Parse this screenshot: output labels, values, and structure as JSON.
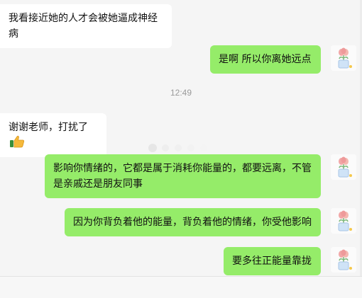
{
  "messages": [
    {
      "from": "other",
      "text": "我看接近她的人才会被她逼成神经病"
    },
    {
      "from": "me",
      "text": "是啊 所以你离她远点"
    },
    {
      "from": "other",
      "text": "谢谢老师，打扰了"
    },
    {
      "from": "me",
      "text": "影响你情绪的，它都是属于消耗你能量的，都要远离，不管是亲戚还是朋友同事"
    },
    {
      "from": "me",
      "text": "因为你背负着他的能量，背负着他的情绪，你受他影响"
    },
    {
      "from": "me",
      "text": "要多往正能量靠拢"
    }
  ],
  "timestamp": "12:49",
  "icons": {
    "avatar": "flower-pot-avatar-icon",
    "thumb": "thumbs-up-icon",
    "loading": "loading-dots-icon"
  },
  "colors": {
    "background": "#f5f5f5",
    "incoming_bubble": "#ffffff",
    "outgoing_bubble": "#95ec69",
    "timestamp": "#9a9a9a"
  }
}
